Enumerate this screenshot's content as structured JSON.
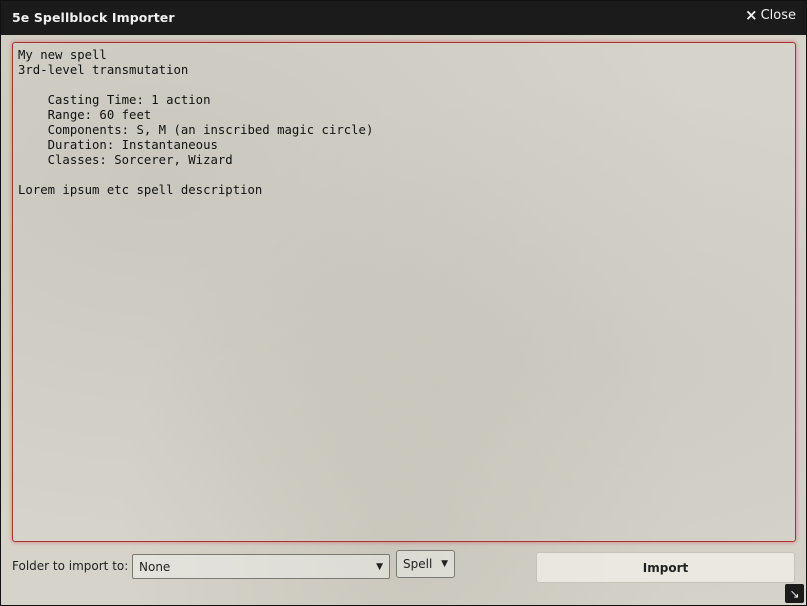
{
  "window": {
    "title": "5e Spellblock Importer",
    "close_label": "Close",
    "close_icon": "×"
  },
  "editor": {
    "content": "My new spell\n3rd-level transmutation\n\n    Casting Time: 1 action\n    Range: 60 feet\n    Components: S, M (an inscribed magic circle)\n    Duration: Instantaneous\n    Classes: Sorcerer, Wizard\n\nLorem ipsum etc spell description"
  },
  "footer": {
    "folder_label": "Folder to import to:",
    "folder_value": "None",
    "type_value": "Spell",
    "import_label": "Import"
  },
  "icons": {
    "close": "close-icon",
    "chevron": "chevron-down-icon",
    "resize": "resize-handle-icon"
  },
  "colors": {
    "titlebar": "#1b1b1b",
    "textarea_border": "#aa3333",
    "background": "#d6d4ca"
  }
}
